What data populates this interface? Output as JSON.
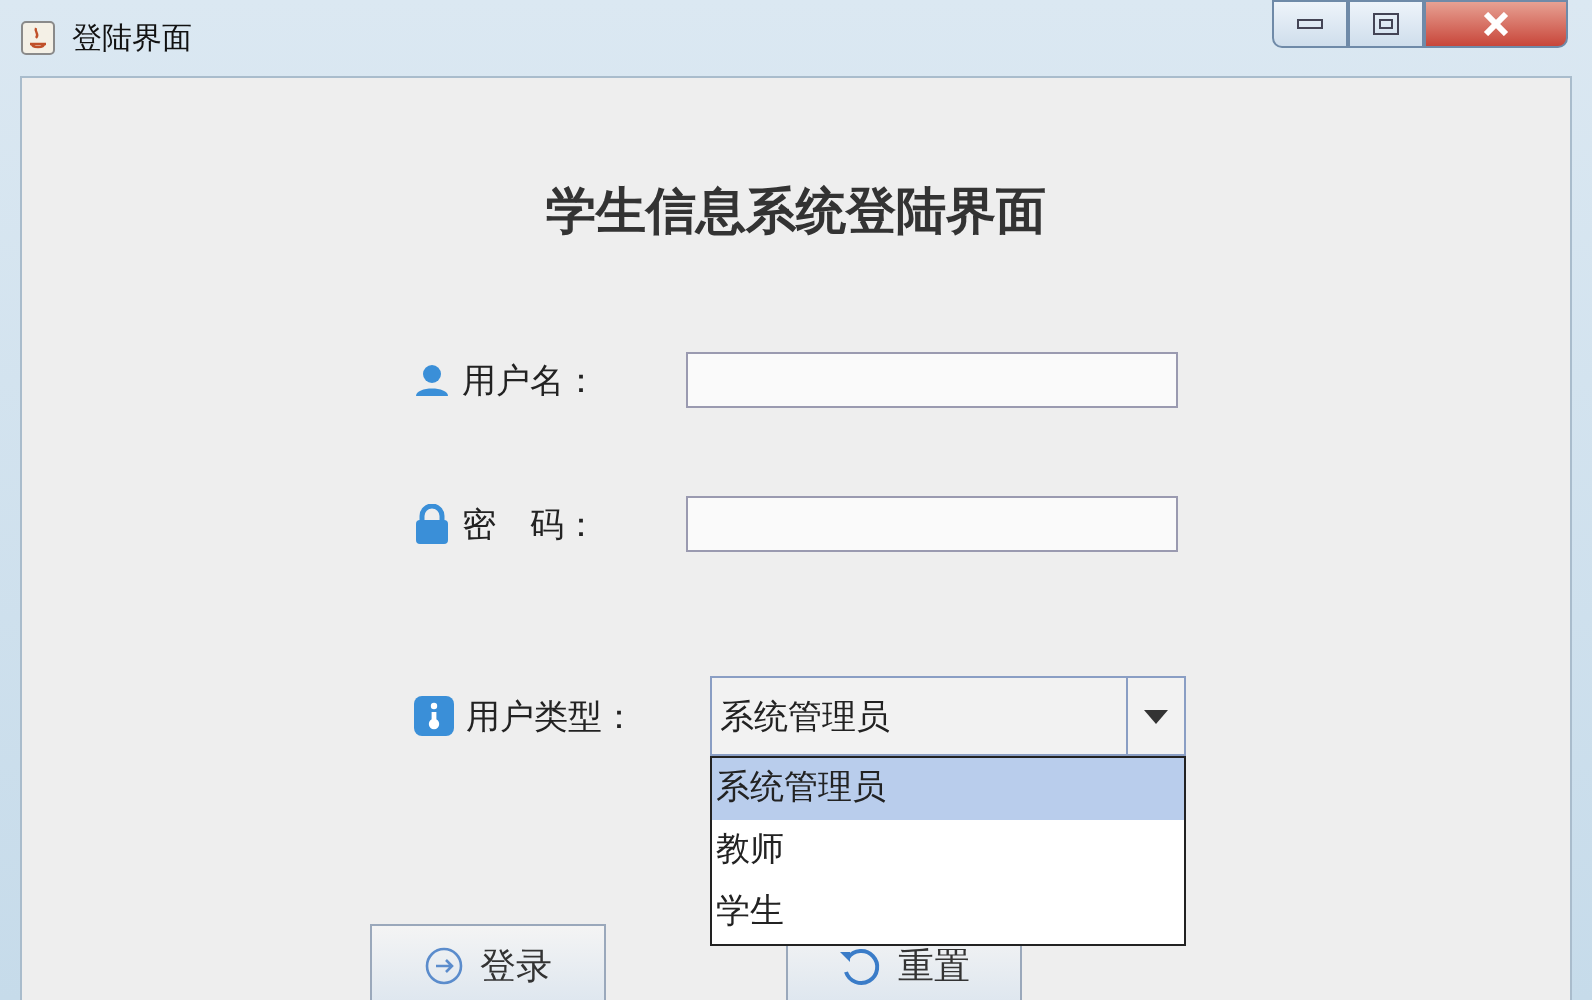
{
  "window": {
    "title": "登陆界面"
  },
  "heading": "学生信息系统登陆界面",
  "fields": [
    {
      "kind": "text",
      "label": "用户名："
    },
    {
      "kind": "password",
      "label": "密　码："
    }
  ],
  "user_type": {
    "label": "用户类型：",
    "value": "系统管理员",
    "expanded": true,
    "options": [
      {
        "label": "系统管理员",
        "selected": true
      },
      {
        "label": "教师",
        "selected": false
      },
      {
        "label": "学生",
        "selected": false
      }
    ]
  },
  "buttons": [
    {
      "kind": "login",
      "label": "登录"
    },
    {
      "kind": "reset",
      "label": "重置"
    }
  ]
}
